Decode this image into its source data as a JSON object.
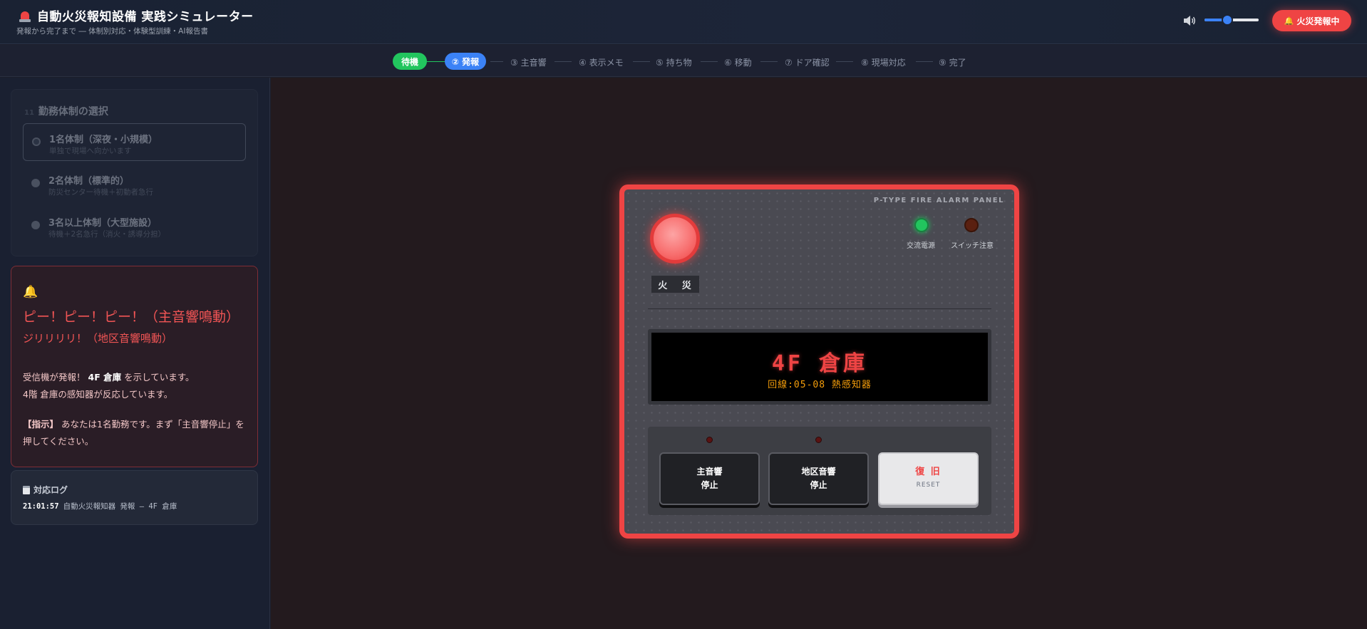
{
  "header": {
    "title": "自動火災報知設備 実践シミュレーター",
    "subtitle": "発報から完了まで ― 体制別対応・体験型訓練・AI報告書",
    "volume_percent": 42,
    "alert_label": "火災発報中"
  },
  "steps": [
    {
      "label": "待機",
      "state": "done"
    },
    {
      "label": "② 発報",
      "state": "current"
    },
    {
      "label": "③ 主音響",
      "state": "pending"
    },
    {
      "label": "④ 表示メモ",
      "state": "pending"
    },
    {
      "label": "⑤ 持ち物",
      "state": "pending"
    },
    {
      "label": "⑥ 移動",
      "state": "pending"
    },
    {
      "label": "⑦ ドア確認",
      "state": "pending"
    },
    {
      "label": "⑧ 現場対応",
      "state": "pending"
    },
    {
      "label": "⑨ 完了",
      "state": "pending"
    }
  ],
  "shift": {
    "number": "11",
    "title": "勤務体制の選択",
    "options": [
      {
        "label": "1名体制（深夜・小規模）",
        "desc": "単独で現場へ向かいます",
        "selected": true
      },
      {
        "label": "2名体制（標準的）",
        "desc": "防災センター待機＋初動者急行",
        "selected": false
      },
      {
        "label": "3名以上体制（大型施設）",
        "desc": "待機＋2名急行（消火・誘導分担）",
        "selected": false
      }
    ]
  },
  "alarm": {
    "headline": "ピー！ピー！ピー！（主音響鳴動）",
    "sub": "ジリリリリ！（地区音響鳴動）",
    "body_pre": "受信機が発報！",
    "body_location": "4F 倉庫",
    "body_post": "を示しています。",
    "body_line2": "4階 倉庫の感知器が反応しています。",
    "instruction_label": "【指示】",
    "instruction_text": "あなたは1名勤務です。まず「主音響停止」を押してください。"
  },
  "log": {
    "title": "対応ログ",
    "entries": [
      {
        "time": "21:01:57",
        "text": "自動火災報知器 発報 ― 4F 倉庫"
      }
    ]
  },
  "panel": {
    "model_label": "P-TYPE FIRE ALARM PANEL",
    "fire_label": "火 災",
    "led_power_label": "交流電源",
    "led_switch_label": "スイッチ注意",
    "display_main": "4F 倉庫",
    "display_sub": "回線:05-08 熱感知器",
    "buttons": {
      "main_stop": [
        "主音響",
        "停止"
      ],
      "area_stop": [
        "地区音響",
        "停止"
      ],
      "reset_main": "復 旧",
      "reset_sub": "RESET"
    }
  },
  "colors": {
    "accent_red": "#ef4444",
    "step_done": "#22c55e",
    "step_current": "#3b82f6",
    "display_amber": "#f59e0b"
  }
}
